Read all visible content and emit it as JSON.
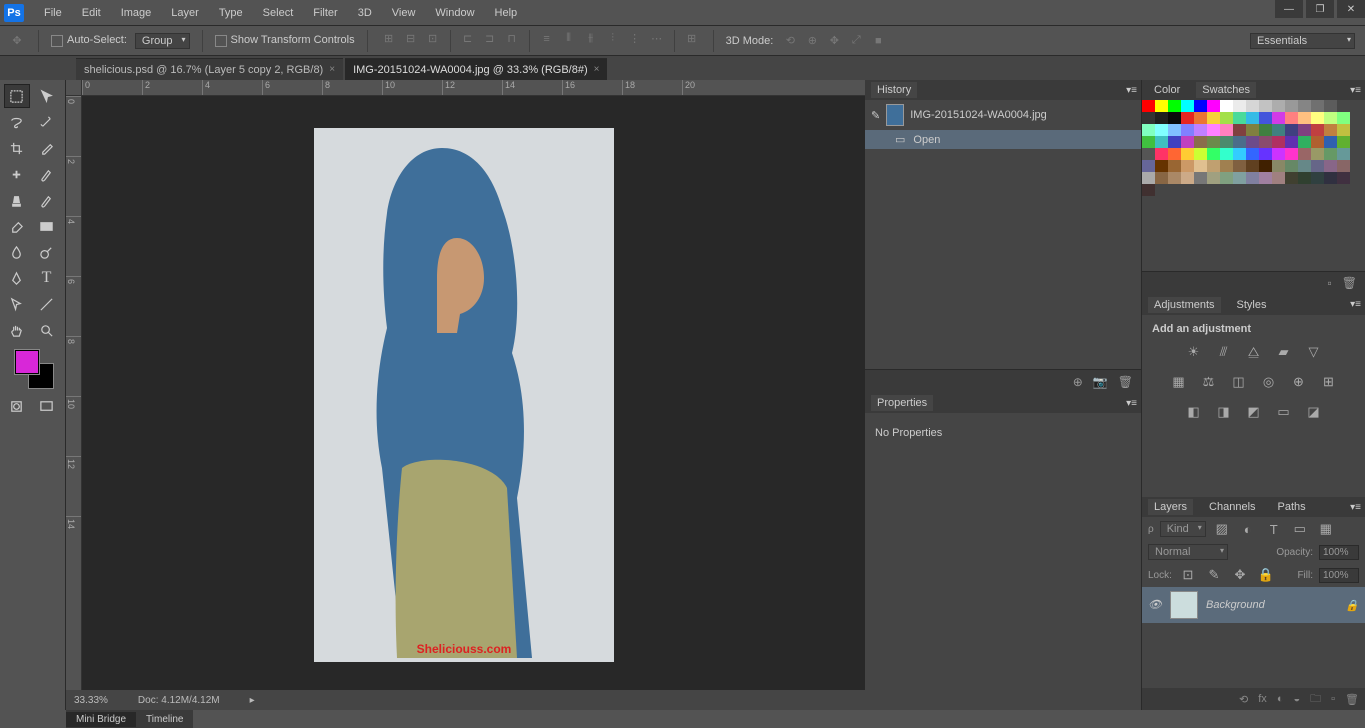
{
  "menu": {
    "items": [
      "File",
      "Edit",
      "Image",
      "Layer",
      "Type",
      "Select",
      "Filter",
      "3D",
      "View",
      "Window",
      "Help"
    ]
  },
  "optbar": {
    "auto_select": "Auto-Select:",
    "group": "Group",
    "show_tc": "Show Transform Controls",
    "mode3d": "3D Mode:",
    "workspace": "Essentials"
  },
  "tabs": [
    {
      "label": "shelicious.psd @ 16.7% (Layer 5 copy 2, RGB/8)",
      "active": false
    },
    {
      "label": "IMG-20151024-WA0004.jpg @ 33.3% (RGB/8#)",
      "active": true
    }
  ],
  "ruler_h": [
    "0",
    "2",
    "4",
    "6",
    "8",
    "10",
    "12",
    "14",
    "16",
    "18",
    "20"
  ],
  "ruler_v": [
    "0",
    "2",
    "4",
    "6",
    "8",
    "10",
    "12",
    "14"
  ],
  "status": {
    "zoom": "33.33%",
    "doc": "Doc: 4.12M/4.12M"
  },
  "footer_tabs": [
    "Mini Bridge",
    "Timeline"
  ],
  "history": {
    "title": "History",
    "doc": "IMG-20151024-WA0004.jpg",
    "step": "Open"
  },
  "properties": {
    "title": "Properties",
    "msg": "No Properties"
  },
  "color": {
    "tab1": "Color",
    "tab2": "Swatches"
  },
  "adjustments": {
    "tab1": "Adjustments",
    "tab2": "Styles",
    "label": "Add an adjustment"
  },
  "layers": {
    "tabs": [
      "Layers",
      "Channels",
      "Paths"
    ],
    "kind": "Kind",
    "blend": "Normal",
    "opacity_lbl": "Opacity:",
    "opacity": "100%",
    "lock_lbl": "Lock:",
    "fill_lbl": "Fill:",
    "fill": "100%",
    "layer": "Background"
  },
  "watermark": "Sheliciouss.com",
  "swatches": [
    "#ff0000",
    "#ffff00",
    "#00ff00",
    "#00ffff",
    "#0000ff",
    "#ff00ff",
    "#ffffff",
    "#ebebeb",
    "#d6d6d6",
    "#c2c2c2",
    "#adadad",
    "#999999",
    "#858585",
    "#707070",
    "#5c5c5c",
    "#474747",
    "#333333",
    "#1f1f1f",
    "#0a0a0a",
    "#e6261f",
    "#eb7532",
    "#f7d038",
    "#a3e048",
    "#49da9a",
    "#34bbe6",
    "#4355db",
    "#d23be7",
    "#ff8080",
    "#ffc080",
    "#ffff80",
    "#c0ff80",
    "#80ff80",
    "#80ffc0",
    "#80ffff",
    "#80c0ff",
    "#8080ff",
    "#c080ff",
    "#ff80ff",
    "#ff80c0",
    "#804040",
    "#808040",
    "#408040",
    "#408080",
    "#404080",
    "#804080",
    "#c04040",
    "#c08040",
    "#c0c040",
    "#40c040",
    "#40c0c0",
    "#4040c0",
    "#c040c0",
    "#8a6d4b",
    "#6b8a4b",
    "#4b8a6d",
    "#4b6d8a",
    "#6d4b8a",
    "#8a4b6d",
    "#b03060",
    "#6030b0",
    "#30b060",
    "#b06030",
    "#3060b0",
    "#60b030",
    "#555555",
    "#ff3366",
    "#ff6633",
    "#ffcc33",
    "#ccff33",
    "#33ff66",
    "#33ffcc",
    "#33ccff",
    "#3366ff",
    "#6633ff",
    "#cc33ff",
    "#ff33cc",
    "#996666",
    "#999966",
    "#669966",
    "#669999",
    "#666699",
    "#663300",
    "#996633",
    "#cc9966",
    "#e0c090",
    "#c0a070",
    "#a08050",
    "#806040",
    "#604020",
    "#402000",
    "#888866",
    "#668866",
    "#668888",
    "#666688",
    "#886688",
    "#886666",
    "#aaaaaa",
    "#886644",
    "#aa8866",
    "#ccaa88",
    "#777777",
    "#a0a080",
    "#80a080",
    "#80a0a0",
    "#8080a0",
    "#a080a0",
    "#a08080",
    "#404030",
    "#304030",
    "#304040",
    "#303040",
    "#403040",
    "#403030"
  ],
  "fg_color": "#d827d8"
}
